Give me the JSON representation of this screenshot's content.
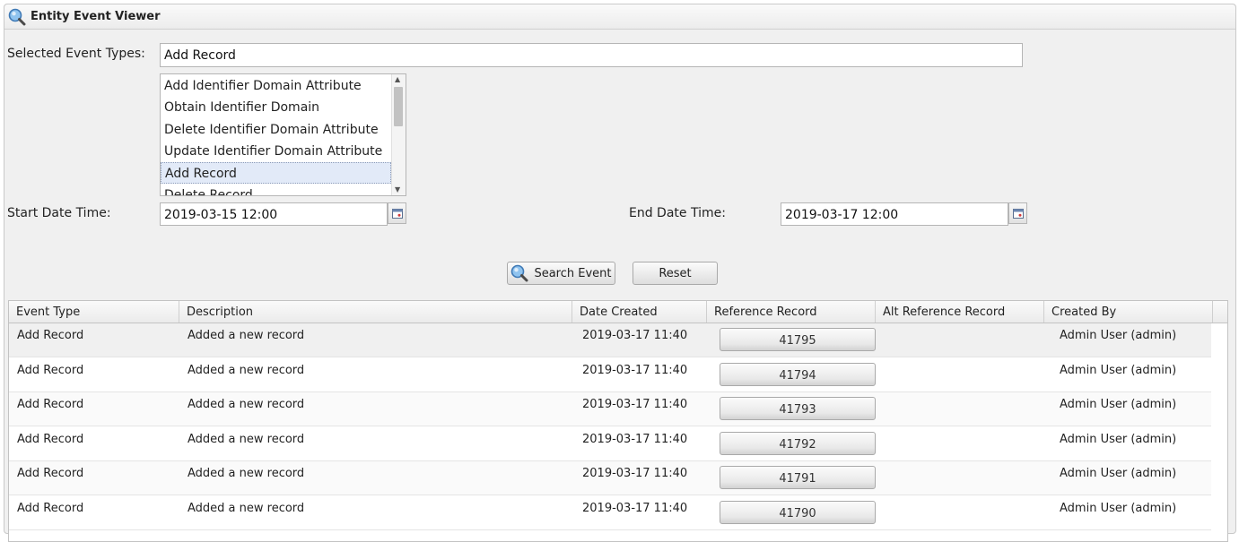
{
  "window": {
    "title": "Entity Event Viewer",
    "icon": "magnifier-icon"
  },
  "filters": {
    "event_types_label": "Selected Event Types:",
    "event_types_value": "Add Record",
    "event_type_options": [
      "Add Identifier Domain Attribute",
      "Obtain Identifier Domain",
      "Delete Identifier Domain Attribute",
      "Update Identifier Domain Attribute",
      "Add Record",
      "Delete Record"
    ],
    "selected_option_index": 4,
    "start_label": "Start Date Time:",
    "start_value": "2019-03-15 12:00",
    "end_label": "End Date Time:",
    "end_value": "2019-03-17 12:00"
  },
  "buttons": {
    "search": "Search Event",
    "reset": "Reset"
  },
  "table": {
    "columns": [
      "Event Type",
      "Description",
      "Date Created",
      "Reference Record",
      "Alt Reference Record",
      "Created By"
    ],
    "rows": [
      {
        "event_type": "Add Record",
        "description": "Added a new record",
        "date": "2019-03-17 11:40",
        "ref": "41795",
        "alt_ref": "",
        "created_by": "Admin User (admin)"
      },
      {
        "event_type": "Add Record",
        "description": "Added a new record",
        "date": "2019-03-17 11:40",
        "ref": "41794",
        "alt_ref": "",
        "created_by": "Admin User (admin)"
      },
      {
        "event_type": "Add Record",
        "description": "Added a new record",
        "date": "2019-03-17 11:40",
        "ref": "41793",
        "alt_ref": "",
        "created_by": "Admin User (admin)"
      },
      {
        "event_type": "Add Record",
        "description": "Added a new record",
        "date": "2019-03-17 11:40",
        "ref": "41792",
        "alt_ref": "",
        "created_by": "Admin User (admin)"
      },
      {
        "event_type": "Add Record",
        "description": "Added a new record",
        "date": "2019-03-17 11:40",
        "ref": "41791",
        "alt_ref": "",
        "created_by": "Admin User (admin)"
      },
      {
        "event_type": "Add Record",
        "description": "Added a new record",
        "date": "2019-03-17 11:40",
        "ref": "41790",
        "alt_ref": "",
        "created_by": "Admin User (admin)"
      }
    ]
  },
  "colors": {
    "panel_bg": "#f0f0f0",
    "selection": "#e2eaf8",
    "border": "#b5b5b5"
  }
}
